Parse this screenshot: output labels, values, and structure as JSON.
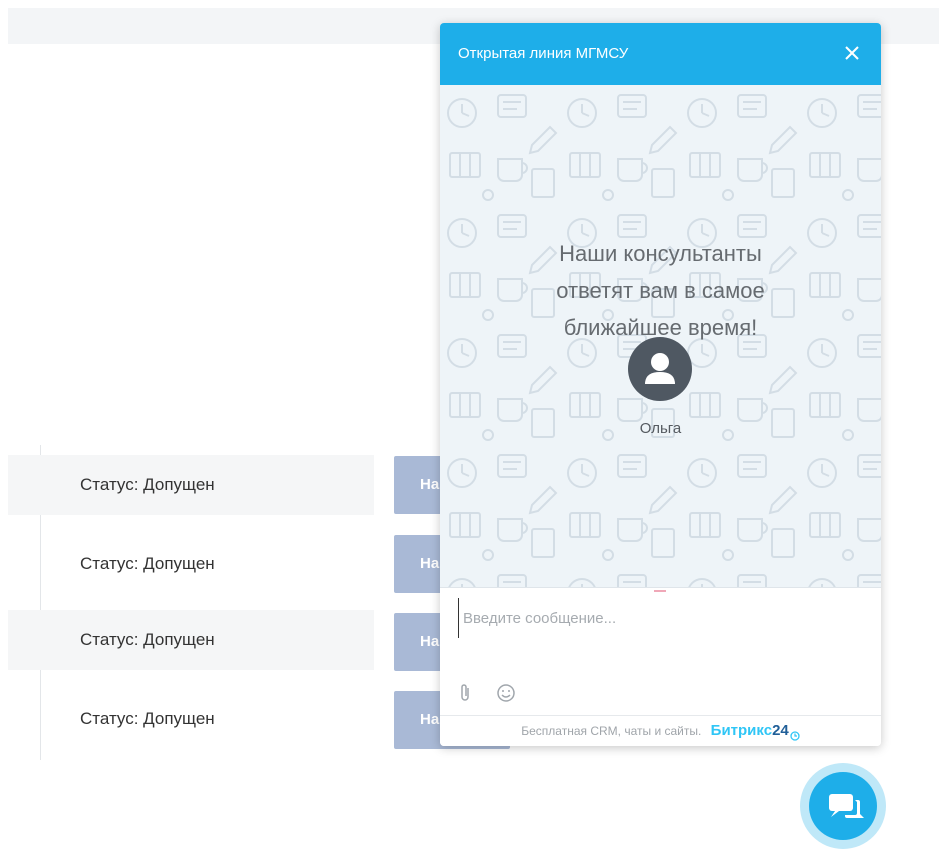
{
  "page": {
    "rows": [
      {
        "status": "Статус: Допущен",
        "button": "На",
        "shaded": true
      },
      {
        "status": "Статус: Допущен",
        "button": "На",
        "shaded": false
      },
      {
        "status": "Статус: Допущен",
        "button": "На",
        "shaded": true
      },
      {
        "status": "Статус: Допущен",
        "button": "На",
        "shaded": false
      }
    ]
  },
  "chat": {
    "title": "Открытая линия МГМСУ",
    "welcome_lines": [
      "Наши консультанты",
      "ответят вам в самое",
      "ближайшее время!"
    ],
    "operator_name": "Ольга",
    "input_placeholder": "Введите сообщение...",
    "footer_text": "Бесплатная CRM, чаты и сайты.",
    "brand_text": "Битрикс",
    "brand_number": "24",
    "icons": {
      "close": "close-icon",
      "attach": "paperclip-icon",
      "emoji": "smile-icon",
      "launcher": "chat-bubbles-icon"
    }
  },
  "colors": {
    "header": "#1eaee9",
    "body_bg": "#eef4f8",
    "row_button": "#a9b9d6",
    "brand": "#2fc6f6"
  }
}
